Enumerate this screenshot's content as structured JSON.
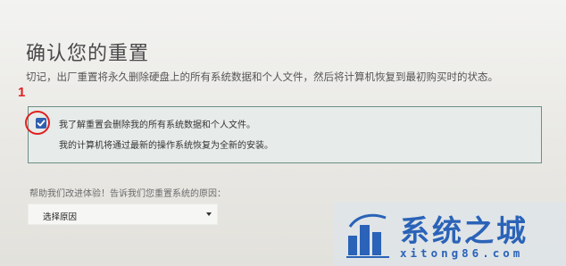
{
  "page": {
    "title": "确认您的重置",
    "warning": "切记，出厂重置将永久删除硬盘上的所有系统数据和个人文件，然后将计算机恢复到最初购买时的状态。"
  },
  "annotation": {
    "number": "1",
    "color": "#e02020"
  },
  "confirm": {
    "checked": true,
    "checkbox_label": "我了解重置会删除我的所有系统数据和个人文件。",
    "description": "我的计算机将通过最新的操作系统恢复为全新的安装。",
    "border_color": "#6b8f86",
    "checkbox_color": "#2f5fb0"
  },
  "feedback": {
    "prompt": "帮助我们改进体验！告诉我们您重置系统的原因：",
    "select_value": "选择原因",
    "caret_icon": "chevron-down-icon"
  },
  "watermark": {
    "title": "系统之城",
    "url": "xitong86.com",
    "color": "#2a63b8"
  }
}
